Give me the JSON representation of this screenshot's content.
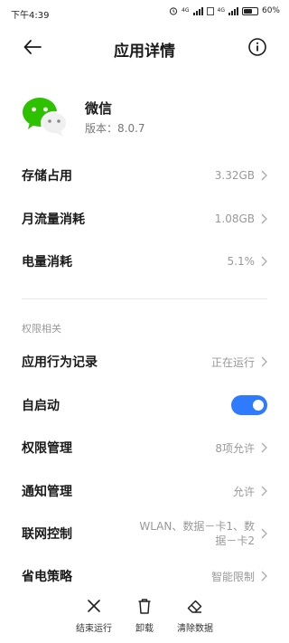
{
  "status_bar": {
    "time": "下午4:39",
    "network_1": "4G",
    "network_2": "4G",
    "battery": "60%"
  },
  "header": {
    "title": "应用详情",
    "back_icon": "back-arrow-icon",
    "info_icon": "info-icon"
  },
  "app": {
    "name": "微信",
    "version": "版本：8.0.7",
    "icon": "wechat-icon",
    "brand_color": "#2dc100"
  },
  "usage": [
    {
      "label": "存储占用",
      "value": "3.32GB"
    },
    {
      "label": "月流量消耗",
      "value": "1.08GB"
    },
    {
      "label": "电量消耗",
      "value": "5.1%"
    }
  ],
  "permissions": {
    "section_label": "权限相关",
    "behavior_log": {
      "label": "应用行为记录",
      "value": "正在运行"
    },
    "autostart": {
      "label": "自启动",
      "enabled": true,
      "toggle_color": "#2f7bff"
    },
    "permission_mgmt": {
      "label": "权限管理",
      "value": "8项允许"
    },
    "notification_mgmt": {
      "label": "通知管理",
      "value": "允许"
    },
    "network_ctrl": {
      "label": "联网控制",
      "value_line1": "WLAN、数据－卡1、数",
      "value_line2": "据－卡2"
    },
    "power_saving": {
      "label": "省电策略",
      "value": "智能限制"
    }
  },
  "bottom_actions": [
    {
      "label": "结束运行",
      "icon": "close-x-icon"
    },
    {
      "label": "卸载",
      "icon": "trash-icon"
    },
    {
      "label": "清除数据",
      "icon": "eraser-icon"
    }
  ]
}
